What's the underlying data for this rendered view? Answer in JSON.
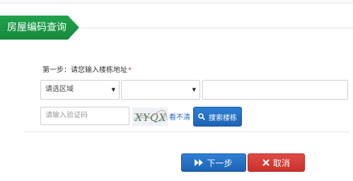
{
  "header": {
    "title": "房屋编码查询"
  },
  "form": {
    "step_label": "第一步：请您输入楼栋地址",
    "required_mark": "*",
    "district_select": {
      "selected": "请选区域",
      "arrow": "▼"
    },
    "street_select": {
      "selected": "",
      "arrow": "▼"
    },
    "address_input": {
      "value": ""
    },
    "captcha_input": {
      "placeholder": "请输入验证码"
    },
    "captcha_image": {
      "text": "XYQX"
    },
    "refresh_link": "看不清",
    "search_button": "搜索楼栋"
  },
  "actions": {
    "next_button": "下一步",
    "cancel_button": "取消"
  },
  "colors": {
    "brand_green": "#1a9444",
    "primary_blue": "#1f63b3",
    "danger_red": "#c9302c",
    "link_blue": "#2a6cc6"
  }
}
